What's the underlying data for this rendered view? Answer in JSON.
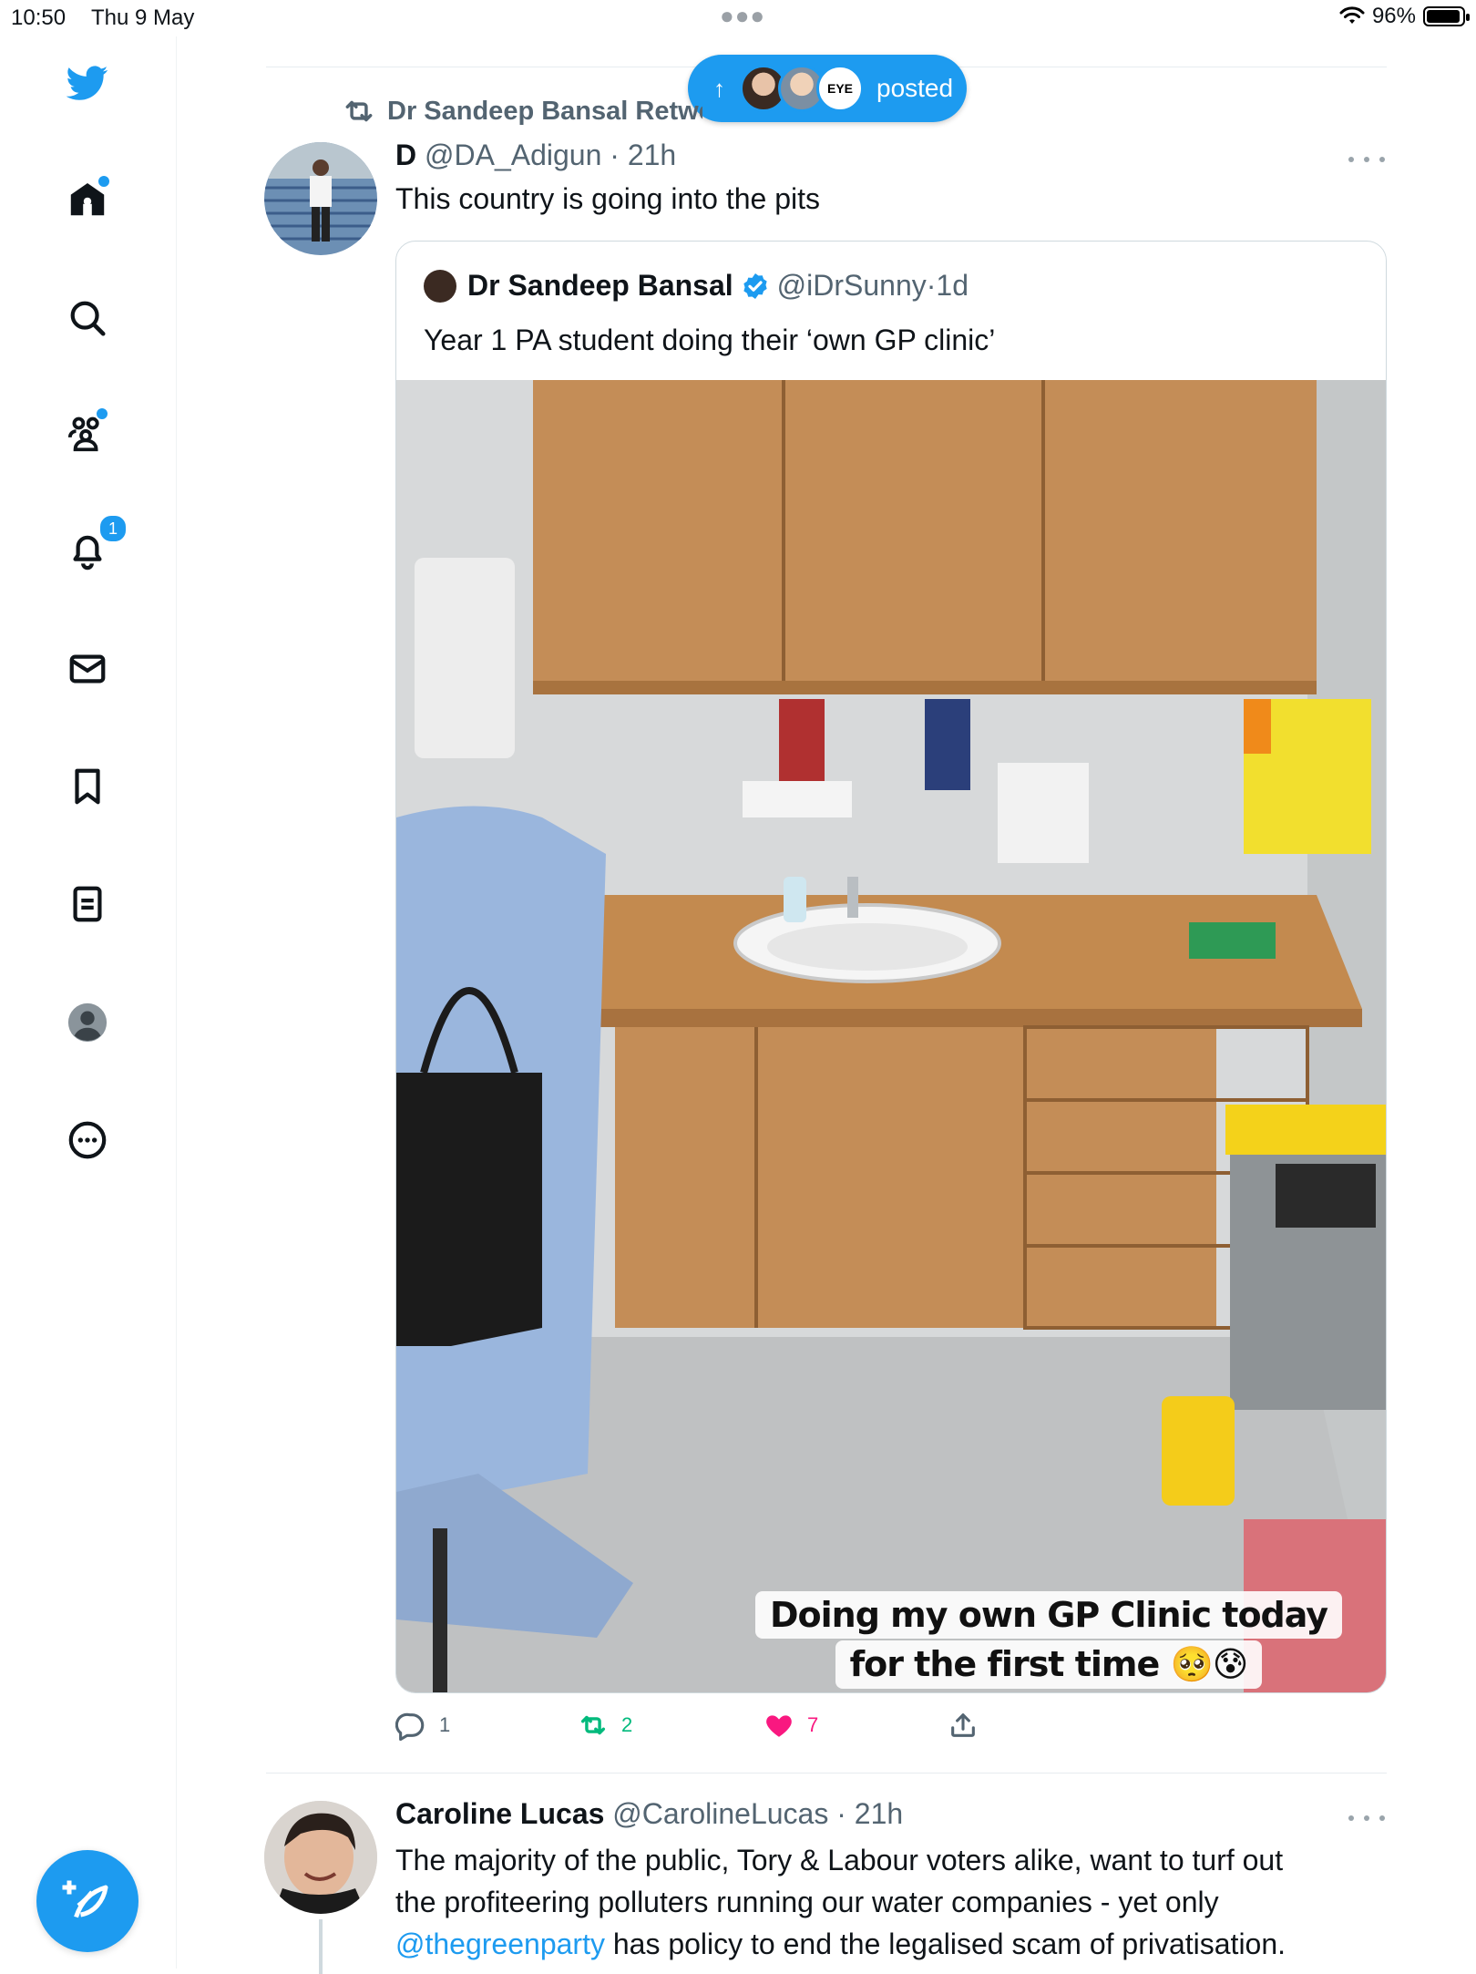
{
  "status_bar": {
    "time": "10:50",
    "date": "Thu 9 May",
    "battery": "96%",
    "battery_level": 0.96
  },
  "sidebar": {
    "items": [
      {
        "name": "home"
      },
      {
        "name": "explore"
      },
      {
        "name": "communities"
      },
      {
        "name": "notifications",
        "badge": "1"
      },
      {
        "name": "messages"
      },
      {
        "name": "bookmarks"
      },
      {
        "name": "lists"
      },
      {
        "name": "profile"
      },
      {
        "name": "more"
      }
    ]
  },
  "new_posts_pill": {
    "label": "posted"
  },
  "tweet1": {
    "retweeted_by": "Dr Sandeep Bansal Retweeted",
    "name": "D",
    "handle": "@DA_Adigun",
    "time": "21h",
    "text": "This country is going into the pits",
    "quote": {
      "name": "Dr Sandeep Bansal",
      "handle": "@iDrSunny",
      "time": "1d",
      "text": "Year 1 PA student doing their ‘own GP clinic’",
      "caption_line1": "Doing my own GP Clinic today",
      "caption_line2": "for the first time 🥺😰"
    },
    "actions": {
      "replies": "1",
      "retweets": "2",
      "likes": "7"
    }
  },
  "tweet2": {
    "name": "Caroline Lucas",
    "handle": "@CarolineLucas",
    "time": "21h",
    "text_line1": "The majority of the public, Tory & Labour voters alike, want to turf out",
    "text_line2": "the profiteering polluters running our water companies - yet only",
    "mention": "@thegreenparty",
    "text_line3": " has policy to end the legalised scam of privatisation."
  },
  "colors": {
    "accent": "#1d9bf0",
    "text": "#0f1419",
    "muted": "#536471",
    "like": "#f91880",
    "retweet": "#00ba7c"
  }
}
